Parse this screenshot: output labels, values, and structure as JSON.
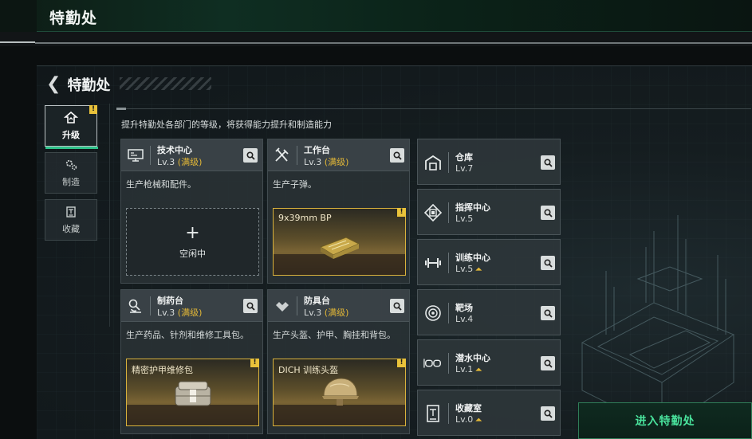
{
  "header": {
    "title": "特勤处"
  },
  "panel": {
    "back_title": "特勤处",
    "description": "提升特勤处各部门的等级，将获得能力提升和制造能力"
  },
  "sidebar": {
    "tabs": [
      {
        "label": "升级",
        "icon": "upgrade-icon",
        "active": true,
        "badge": "!"
      },
      {
        "label": "制造",
        "icon": "gears-icon",
        "active": false
      },
      {
        "label": "收藏",
        "icon": "collection-icon",
        "active": false
      }
    ]
  },
  "workshops": [
    {
      "name": "技术中心",
      "level": "Lv.3",
      "level_note": "(满级)",
      "desc": "生产枪械和配件。",
      "slot_state": "idle",
      "slot_text": "空闲中",
      "icon": "computer-icon"
    },
    {
      "name": "工作台",
      "level": "Lv.3",
      "level_note": "(满级)",
      "desc": "生产子弹。",
      "slot_state": "producing",
      "slot_item": "9x39mm BP",
      "badge": "!",
      "icon": "tools-icon"
    },
    {
      "name": "制药台",
      "level": "Lv.3",
      "level_note": "(满级)",
      "desc": "生产药品、针剂和维修工具包。",
      "slot_state": "producing",
      "slot_item": "精密护甲维修包",
      "badge": "!",
      "icon": "microscope-icon"
    },
    {
      "name": "防具台",
      "level": "Lv.3",
      "level_note": "(满级)",
      "desc": "生产头盔、护甲、胸挂和背包。",
      "slot_state": "producing",
      "slot_item": "DICH 训练头盔",
      "badge": "!",
      "icon": "armor-icon"
    }
  ],
  "rooms": [
    {
      "name": "仓库",
      "level": "Lv.7",
      "upgrade": false,
      "icon": "warehouse-icon"
    },
    {
      "name": "指挥中心",
      "level": "Lv.5",
      "upgrade": false,
      "icon": "chip-icon"
    },
    {
      "name": "训练中心",
      "level": "Lv.5",
      "upgrade": true,
      "icon": "dumbbell-icon"
    },
    {
      "name": "靶场",
      "level": "Lv.4",
      "upgrade": false,
      "icon": "target-icon"
    },
    {
      "name": "潜水中心",
      "level": "Lv.1",
      "upgrade": true,
      "icon": "goggles-icon"
    },
    {
      "name": "收藏室",
      "level": "Lv.0",
      "upgrade": true,
      "icon": "display-case-icon"
    }
  ],
  "upgrade_symbol": "⏶",
  "enter_button": {
    "label": "进入特勤处"
  },
  "colors": {
    "accent_green": "#49e29c",
    "max_level_gold": "#e2b737",
    "badge_yellow": "#e9c23a"
  }
}
